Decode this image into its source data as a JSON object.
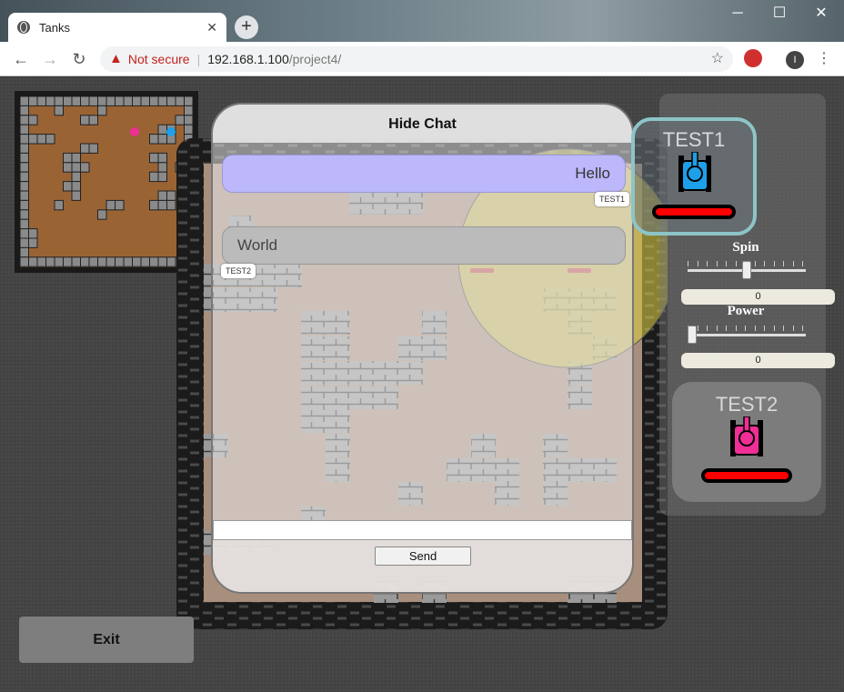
{
  "browser": {
    "tab_title": "Tanks",
    "new_tab_icon": "+",
    "url_warning": "Not secure",
    "url_host": "192.168.1.100",
    "url_path": "/project4/",
    "account_initial": "I"
  },
  "chat": {
    "header": "Hide Chat",
    "messages": [
      {
        "text": "Hello",
        "sender": "TEST1"
      },
      {
        "text": "World",
        "sender": "TEST2"
      }
    ],
    "input_value": "",
    "send_label": "Send"
  },
  "players": [
    {
      "name": "TEST1",
      "color": "#1ea0e8"
    },
    {
      "name": "TEST2",
      "color": "#ef2e96"
    }
  ],
  "controls": {
    "spin_label": "Spin",
    "spin_value": "0",
    "power_label": "Power",
    "power_value": "0"
  },
  "exit_label": "Exit",
  "colors": {
    "dirt": "#9a6334",
    "arena_floor": "#a88e7c",
    "shield": "#d4c842"
  }
}
